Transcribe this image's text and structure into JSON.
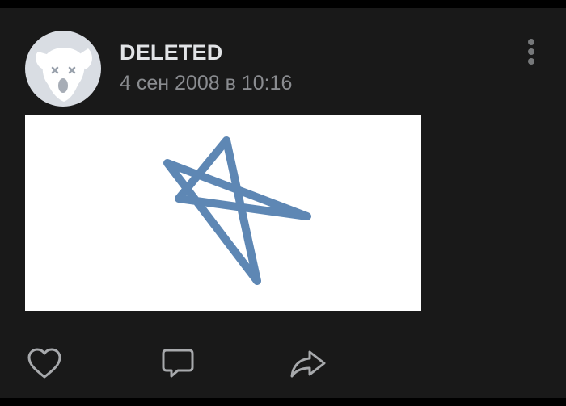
{
  "post": {
    "author": "DELETED",
    "date": "4 сен 2008 в 10:16",
    "avatar_icon": "deleted-user-dog-icon",
    "menu_icon": "more-vertical-icon",
    "image": {
      "content": "hand-drawn star",
      "stroke_color": "#5e87b4",
      "background": "#ffffff"
    },
    "actions": [
      {
        "icon": "like-heart-icon"
      },
      {
        "icon": "comment-icon"
      },
      {
        "icon": "share-icon"
      }
    ]
  },
  "colors": {
    "background": "#191919",
    "author_text": "#e1e3e6",
    "secondary_text": "#8a8c90",
    "icon": "#a7a9ac"
  }
}
